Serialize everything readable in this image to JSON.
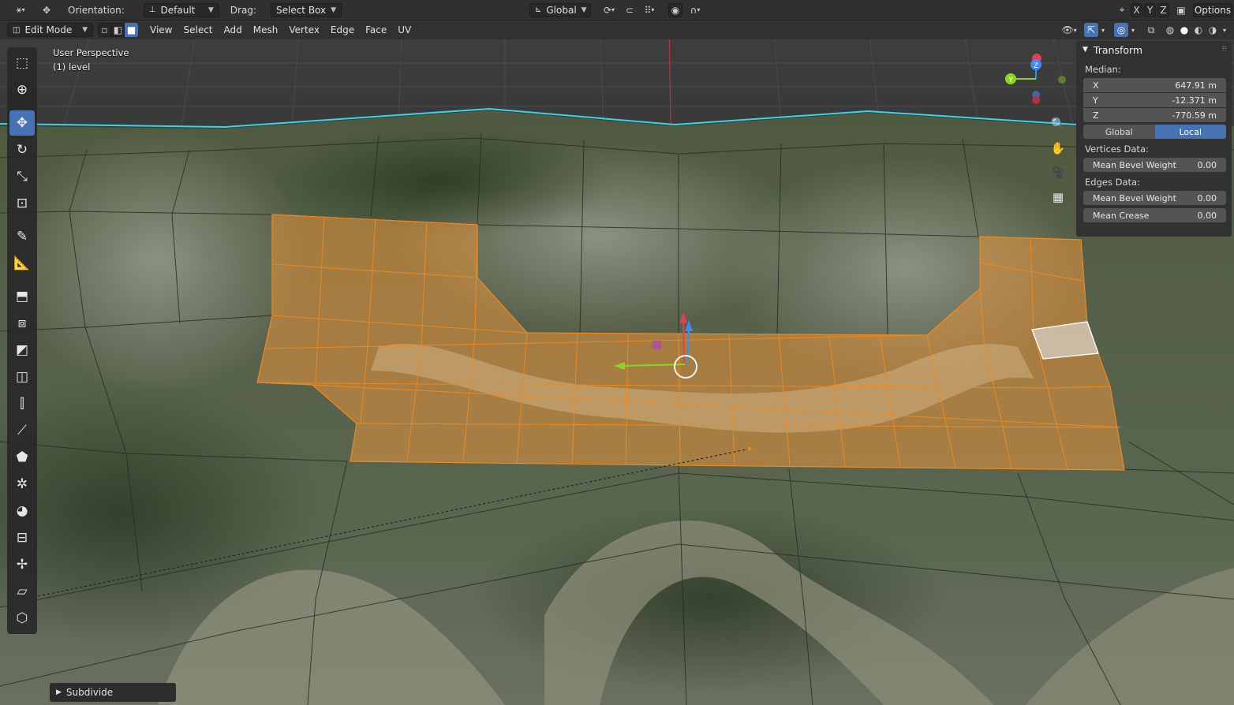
{
  "topbar": {
    "orientation_label": "Orientation:",
    "orientation_value": "Default",
    "drag_label": "Drag:",
    "drag_value": "Select Box",
    "transform_orientation": "Global",
    "axis_x": "X",
    "axis_y": "Y",
    "axis_z": "Z",
    "options": "Options"
  },
  "header": {
    "mode": "Edit Mode",
    "menus": [
      "View",
      "Select",
      "Add",
      "Mesh",
      "Vertex",
      "Edge",
      "Face",
      "UV"
    ]
  },
  "viewport": {
    "perspective_text": "User Perspective",
    "object_text": "(1) level",
    "gizmo_axes": {
      "x": "",
      "y": "Y",
      "z": "Z"
    }
  },
  "toolbar": {
    "tools": [
      "select-box",
      "cursor",
      "move",
      "rotate",
      "scale",
      "transform",
      "annotate",
      "measure",
      "add-cube",
      "extrude",
      "inset",
      "bevel",
      "loop-cut",
      "knife",
      "poly-build",
      "spin",
      "smooth",
      "edge-slide",
      "shrink-fatten",
      "shear",
      "rip"
    ],
    "active": "move"
  },
  "npanel": {
    "title": "Transform",
    "median_label": "Median:",
    "x_label": "X",
    "x_value": "647.91 m",
    "y_label": "Y",
    "y_value": "-12.371 m",
    "z_label": "Z",
    "z_value": "-770.59 m",
    "global_btn": "Global",
    "local_btn": "Local",
    "vertices_label": "Vertices Data:",
    "vert_bevel_label": "Mean Bevel Weight",
    "vert_bevel_value": "0.00",
    "edges_label": "Edges Data:",
    "edge_bevel_label": "Mean Bevel Weight",
    "edge_bevel_value": "0.00",
    "crease_label": "Mean Crease",
    "crease_value": "0.00"
  },
  "operator_panel": {
    "label": "Subdivide"
  },
  "colors": {
    "accent": "#4772b3",
    "selection": "#e8943a",
    "terrain_dark": "#3c4a30",
    "terrain_light": "#8e8f78",
    "boundary": "#35d6e8"
  }
}
